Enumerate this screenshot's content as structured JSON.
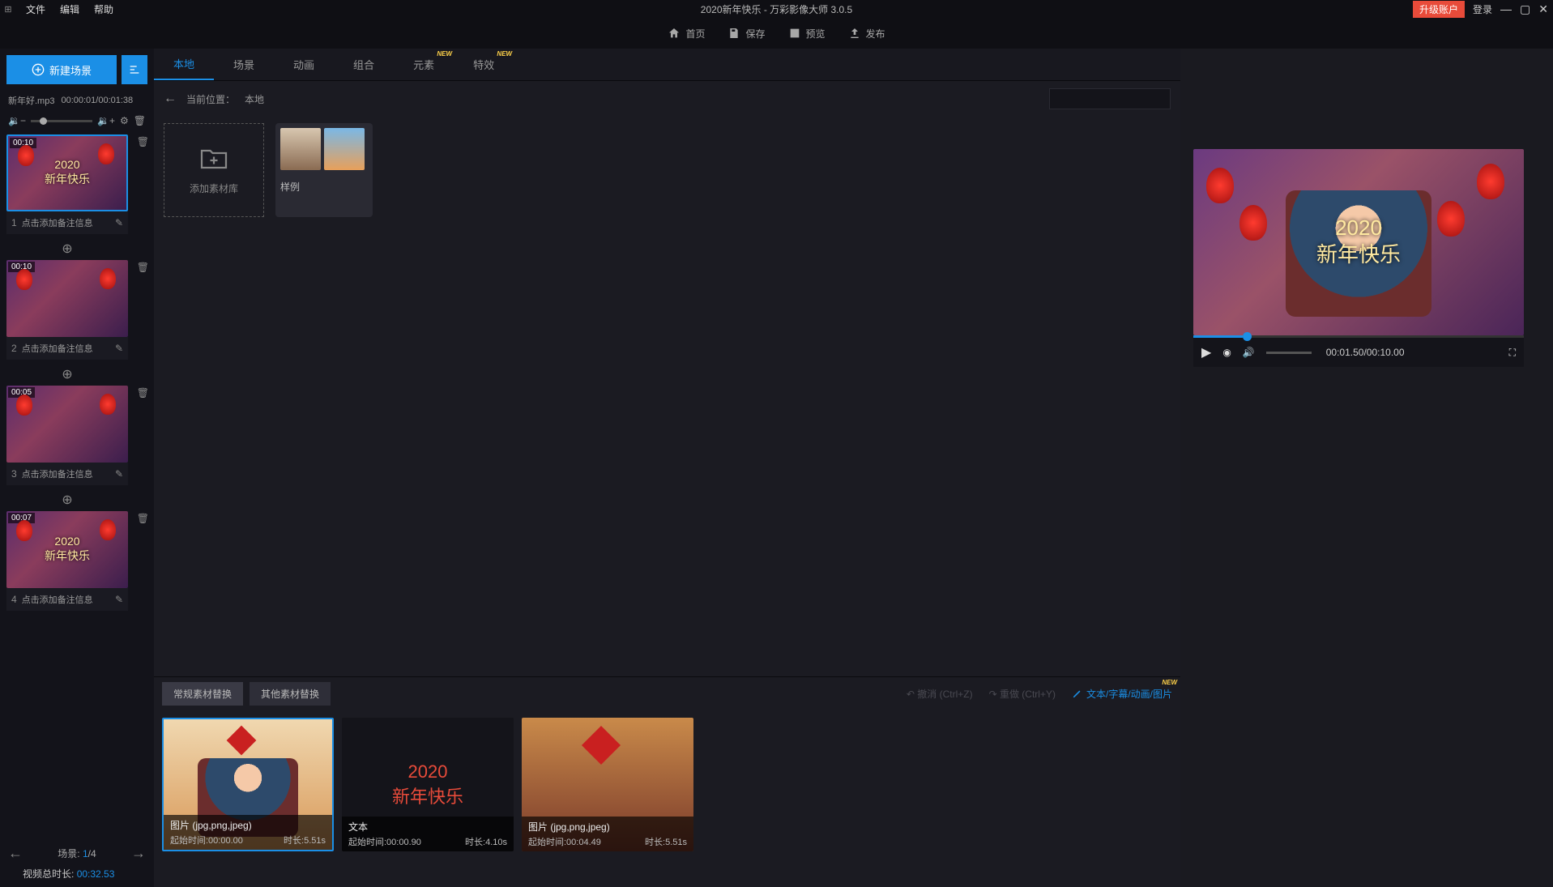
{
  "titlebar": {
    "menu": {
      "file": "文件",
      "edit": "编辑",
      "help": "帮助"
    },
    "title": "2020新年快乐 - 万彩影像大师 3.0.5",
    "upgrade": "升级账户",
    "login": "登录"
  },
  "toolbar": {
    "home": "首页",
    "save": "保存",
    "preview": "预览",
    "publish": "发布"
  },
  "sidebar": {
    "new_scene": "新建场景",
    "audio_file": "新年好.mp3",
    "audio_time": "00:00:01/00:01:38",
    "scenes": [
      {
        "duration": "00:10",
        "idx": "1",
        "caption": "点击添加备注信息",
        "overlay_l1": "2020",
        "overlay_l2": "新年快乐",
        "selected": true
      },
      {
        "duration": "00:10",
        "idx": "2",
        "caption": "点击添加备注信息",
        "overlay_l1": "",
        "overlay_l2": "",
        "selected": false
      },
      {
        "duration": "00:05",
        "idx": "3",
        "caption": "点击添加备注信息",
        "overlay_l1": "",
        "overlay_l2": "",
        "selected": false
      },
      {
        "duration": "00:07",
        "idx": "4",
        "caption": "点击添加备注信息",
        "overlay_l1": "2020",
        "overlay_l2": "新年快乐",
        "selected": false
      }
    ],
    "page_label": "场景:",
    "page_current": "1",
    "page_total": "/4",
    "total_label": "视频总时长:",
    "total_value": "00:32.53"
  },
  "center": {
    "tabs": [
      {
        "label": "本地",
        "active": true,
        "new": false
      },
      {
        "label": "场景",
        "active": false,
        "new": false
      },
      {
        "label": "动画",
        "active": false,
        "new": false
      },
      {
        "label": "组合",
        "active": false,
        "new": false
      },
      {
        "label": "元素",
        "active": false,
        "new": true
      },
      {
        "label": "特效",
        "active": false,
        "new": true
      }
    ],
    "breadcrumb_label": "当前位置：",
    "breadcrumb_value": "本地",
    "search_placeholder": "",
    "add_library": "添加素材库",
    "sample_folder": "样例"
  },
  "bottom": {
    "tab1": "常规素材替换",
    "tab2": "其他素材替换",
    "undo": "撤消 (Ctrl+Z)",
    "redo": "重做 (Ctrl+Y)",
    "link": "文本/字幕/动画/图片",
    "clips": [
      {
        "type": "图片  (jpg,png,jpeg)",
        "start": "起始时间:00:00.00",
        "dur": "时长:5.51s",
        "selected": true,
        "kind": "family"
      },
      {
        "type": "文本",
        "start": "起始时间:00:00.90",
        "dur": "时长:4.10s",
        "selected": false,
        "kind": "text",
        "l1": "2020",
        "l2": "新年快乐"
      },
      {
        "type": "图片  (jpg,png,jpeg)",
        "start": "起始时间:00:04.49",
        "dur": "时长:5.51s",
        "selected": false,
        "kind": "scene"
      }
    ]
  },
  "preview": {
    "overlay_l1": "2020",
    "overlay_l2": "新年快乐",
    "time": "00:01.50/00:10.00"
  },
  "new_badge": "NEW"
}
